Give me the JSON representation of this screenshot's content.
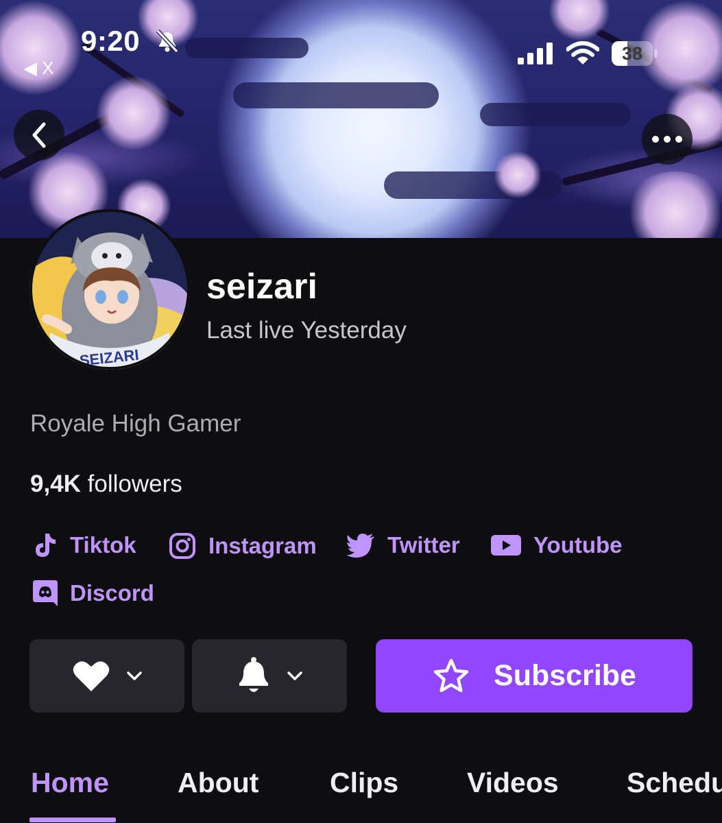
{
  "status_bar": {
    "time": "9:20",
    "back_app": "◀ X",
    "battery": "38",
    "battery_level": 0.38,
    "icons": [
      "bell-slash-icon",
      "cellular-signal-icon",
      "wifi-icon",
      "battery-icon"
    ]
  },
  "header": {
    "back_icon": "chevron-left-icon",
    "more_icon": "ellipsis-icon"
  },
  "channel": {
    "name": "seizari",
    "last_live": "Last live Yesterday",
    "bio": "Royale High Gamer",
    "followers_count": "9,4K",
    "followers_label": "followers",
    "avatar_text": "SEIZARI"
  },
  "social_links": [
    {
      "label": "Tiktok",
      "icon": "tiktok-icon"
    },
    {
      "label": "Instagram",
      "icon": "instagram-icon"
    },
    {
      "label": "Twitter",
      "icon": "twitter-icon"
    },
    {
      "label": "Youtube",
      "icon": "youtube-icon"
    },
    {
      "label": "Discord",
      "icon": "discord-icon"
    }
  ],
  "actions": {
    "follow_icon": "heart-icon",
    "notify_icon": "bell-icon",
    "subscribe_label": "Subscribe",
    "subscribe_icon": "star-icon"
  },
  "tabs": [
    {
      "label": "Home",
      "active": true
    },
    {
      "label": "About",
      "active": false
    },
    {
      "label": "Clips",
      "active": false
    },
    {
      "label": "Videos",
      "active": false
    },
    {
      "label": "Schedule",
      "active": false
    }
  ],
  "colors": {
    "background": "#0e0e10",
    "accent": "#9147ff",
    "accent_text": "#bf94ff",
    "button_dark": "#26262c"
  }
}
